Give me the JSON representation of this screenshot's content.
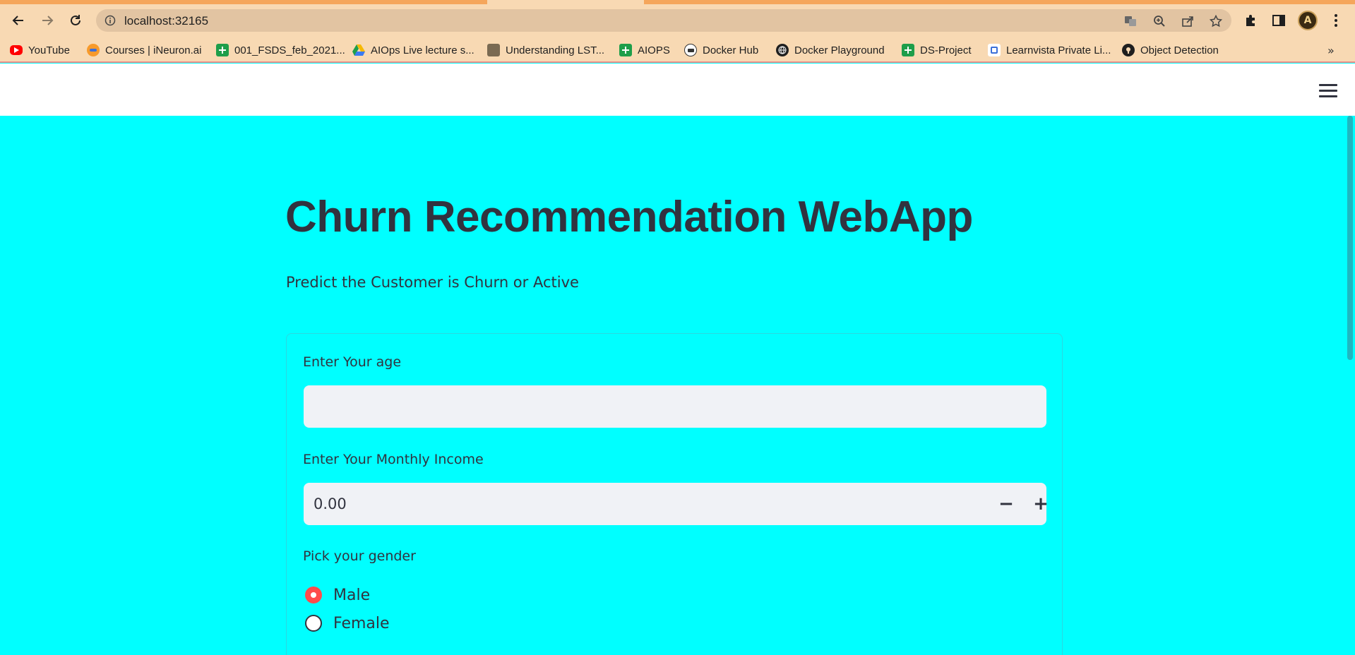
{
  "browser": {
    "url": "localhost:32165",
    "avatar_initial": "A",
    "bookmarks": [
      {
        "label": "YouTube",
        "icon": "youtube-icon"
      },
      {
        "label": "Courses | iNeuron.ai",
        "icon": "ineuron-icon"
      },
      {
        "label": "001_FSDS_feb_2021...",
        "icon": "sheets-icon"
      },
      {
        "label": "AIOps Live lecture s...",
        "icon": "drive-icon"
      },
      {
        "label": "Understanding LST...",
        "icon": "image-icon"
      },
      {
        "label": "AIOPS",
        "icon": "sheets-icon"
      },
      {
        "label": "Docker Hub",
        "icon": "docker-icon"
      },
      {
        "label": "Docker Playground",
        "icon": "globe-icon"
      },
      {
        "label": "DS-Project",
        "icon": "sheets-icon"
      },
      {
        "label": "Learnvista Private Li...",
        "icon": "learnvista-icon"
      },
      {
        "label": "Object Detection",
        "icon": "github-icon"
      }
    ],
    "more_bookmarks": "»"
  },
  "app": {
    "title": "Churn Recommendation WebApp",
    "subtitle": "Predict the Customer is Churn or Active",
    "form": {
      "age_label": "Enter Your age",
      "age_value": "",
      "income_label": "Enter Your Monthly Income",
      "income_value": "0.00",
      "minus": "−",
      "plus": "+",
      "gender_label": "Pick your gender",
      "gender_options": [
        "Male",
        "Female"
      ],
      "gender_selected": "Male"
    }
  },
  "colors": {
    "app_background": "#00ffff",
    "text": "#31333f",
    "accent_radio": "#ff4b4b",
    "input_background": "#f0f2f6"
  }
}
